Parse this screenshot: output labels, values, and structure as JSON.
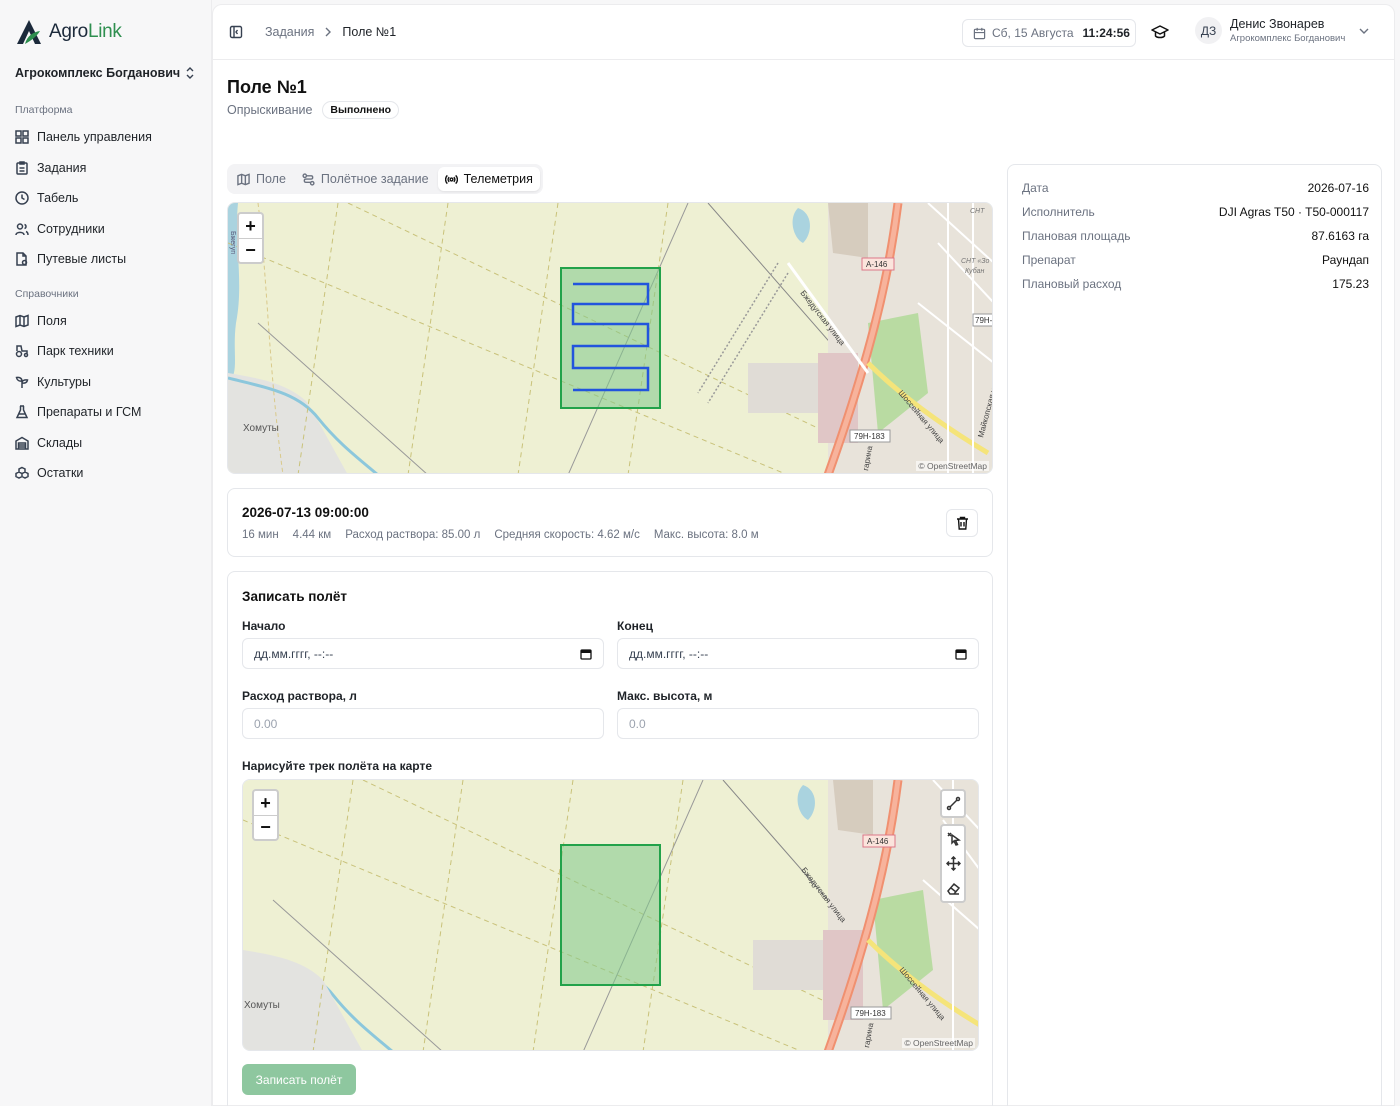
{
  "app": {
    "name_prefix": "Agro",
    "name_suffix": "Link",
    "organization": "Агрокомплекс Богданович"
  },
  "sidebar": {
    "section_platform": "Платформа",
    "section_refs": "Справочники",
    "items": [
      {
        "label": "Панель управления",
        "icon": "dashboard-icon"
      },
      {
        "label": "Задания",
        "icon": "clipboard-icon"
      },
      {
        "label": "Табель",
        "icon": "clock-icon"
      },
      {
        "label": "Сотрудники",
        "icon": "users-icon"
      },
      {
        "label": "Путевые листы",
        "icon": "waybill-icon"
      },
      {
        "label": "Поля",
        "icon": "map-icon"
      },
      {
        "label": "Парк техники",
        "icon": "tractor-icon"
      },
      {
        "label": "Культуры",
        "icon": "sprout-icon"
      },
      {
        "label": "Препараты и ГСМ",
        "icon": "flask-icon"
      },
      {
        "label": "Склады",
        "icon": "warehouse-icon"
      },
      {
        "label": "Остатки",
        "icon": "boxes-icon"
      }
    ]
  },
  "header": {
    "breadcrumb_parent": "Задания",
    "breadcrumb_current": "Поле №1",
    "date_text": "Сб, 15 Августа",
    "time_text": "11:24:56",
    "user_initials": "ДЗ",
    "user_name": "Денис Звонарев",
    "user_org": "Агрокомплекс Богданович"
  },
  "page": {
    "title": "Поле №1",
    "subtitle": "Опрыскивание",
    "status": "Выполнено"
  },
  "tabs": [
    {
      "label": "Поле",
      "icon": "map-icon",
      "active": false
    },
    {
      "label": "Полётное задание",
      "icon": "route-icon",
      "active": false
    },
    {
      "label": "Телеметрия",
      "icon": "radio-icon",
      "active": true
    }
  ],
  "map": {
    "labels": {
      "village": "Хомуты",
      "road_a146": "А-146",
      "road_79h183": "79Н-183",
      "road_79h": "79Н-",
      "street_1": "Бжедугская улица",
      "street_2": "Шоссейная улица",
      "street_3": "Майкопская улица",
      "street_4": "гарина",
      "cnt": "СНТ",
      "cnt2": "СНТ «Зо",
      "kuban": "Кубан",
      "river": "Бжегуп"
    },
    "zoom_in": "+",
    "zoom_out": "−",
    "attribution": "© OpenStreetMap",
    "colors": {
      "field_fill": "#7fc98a",
      "field_stroke": "#22a24a",
      "track": "#2255dd",
      "base": "#eef0d3",
      "road_main": "#f09070",
      "road_yellow": "#f5e47a"
    }
  },
  "flight": {
    "datetime": "2026-07-13 09:00:00",
    "duration": "16 мин",
    "distance": "4.44 км",
    "solution": "Расход раствора: 85.00 л",
    "speed": "Средняя скорость: 4.62 м/с",
    "altitude": "Макс. высота: 8.0 м"
  },
  "form": {
    "title": "Записать полёт",
    "start_label": "Начало",
    "start_placeholder": "дд.мм.гггг, --:--",
    "end_label": "Конец",
    "end_placeholder": "дд.мм.гггг, --:--",
    "solution_label": "Расход раствора, л",
    "solution_placeholder": "0.00",
    "altitude_label": "Макс. высота, м",
    "altitude_placeholder": "0.0",
    "draw_label": "Нарисуйте трек полёта на карте",
    "submit_label": "Записать полёт"
  },
  "info": {
    "rows": [
      {
        "key": "Дата",
        "value": "2026-07-16"
      },
      {
        "key": "Исполнитель",
        "value": "DJI Agras T50 · T50-000117"
      },
      {
        "key": "Плановая площадь",
        "value": "87.6163 га"
      },
      {
        "key": "Препарат",
        "value": "Раундап"
      },
      {
        "key": "Плановый расход",
        "value": "175.23"
      }
    ]
  }
}
